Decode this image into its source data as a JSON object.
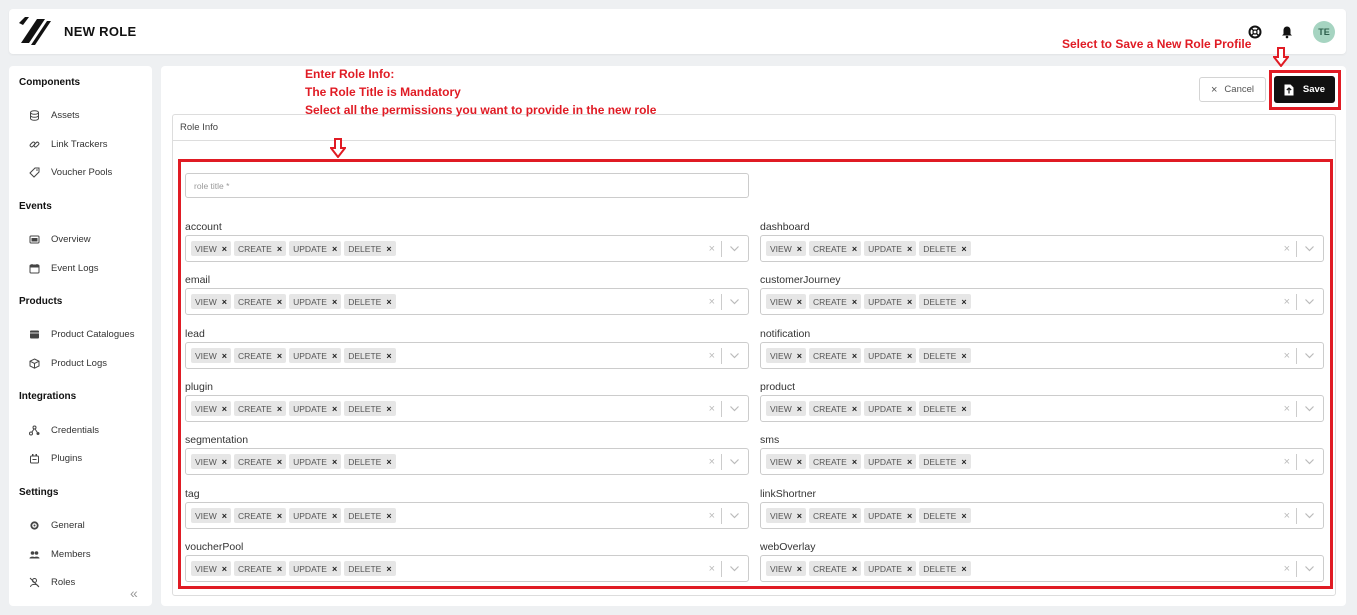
{
  "header": {
    "title": "NEW ROLE",
    "avatar_initials": "TE",
    "icons": [
      "help-icon",
      "bell-icon"
    ]
  },
  "sidebar": {
    "sections": [
      {
        "heading": "Components",
        "items": [
          {
            "label": "Assets",
            "icon": "database-icon"
          },
          {
            "label": "Link Trackers",
            "icon": "link-icon"
          },
          {
            "label": "Voucher Pools",
            "icon": "tag-icon"
          }
        ]
      },
      {
        "heading": "Events",
        "items": [
          {
            "label": "Overview",
            "icon": "overview-icon"
          },
          {
            "label": "Event Logs",
            "icon": "calendar-icon"
          }
        ]
      },
      {
        "heading": "Products",
        "items": [
          {
            "label": "Product Catalogues",
            "icon": "catalogue-icon"
          },
          {
            "label": "Product Logs",
            "icon": "box-icon"
          }
        ]
      },
      {
        "heading": "Integrations",
        "items": [
          {
            "label": "Credentials",
            "icon": "credentials-icon"
          },
          {
            "label": "Plugins",
            "icon": "plugin-icon"
          }
        ]
      },
      {
        "heading": "Settings",
        "items": [
          {
            "label": "General",
            "icon": "gear-icon"
          },
          {
            "label": "Members",
            "icon": "members-icon"
          },
          {
            "label": "Roles",
            "icon": "roles-icon"
          }
        ]
      }
    ]
  },
  "toolbar": {
    "cancel_label": "Cancel",
    "save_label": "Save"
  },
  "role_info": {
    "panel_title": "Role Info",
    "title_placeholder": "role title *"
  },
  "permissions": {
    "chips": [
      "VIEW",
      "CREATE",
      "UPDATE",
      "DELETE"
    ],
    "left": [
      "account",
      "email",
      "lead",
      "plugin",
      "segmentation",
      "tag",
      "voucherPool"
    ],
    "right": [
      "dashboard",
      "customerJourney",
      "notification",
      "product",
      "sms",
      "linkShortner",
      "webOverlay"
    ]
  },
  "annotations": {
    "save_note": "Select to Save a New Role Profile",
    "role_note_line1": "Enter Role Info:",
    "role_note_line2": "The Role Title is Mandatory",
    "role_note_line3": "Select all the permissions you want to provide in the new role"
  },
  "colors": {
    "annotation_red": "#e01b24",
    "save_button": "#111111",
    "avatar_bg": "#a6d4c1"
  }
}
